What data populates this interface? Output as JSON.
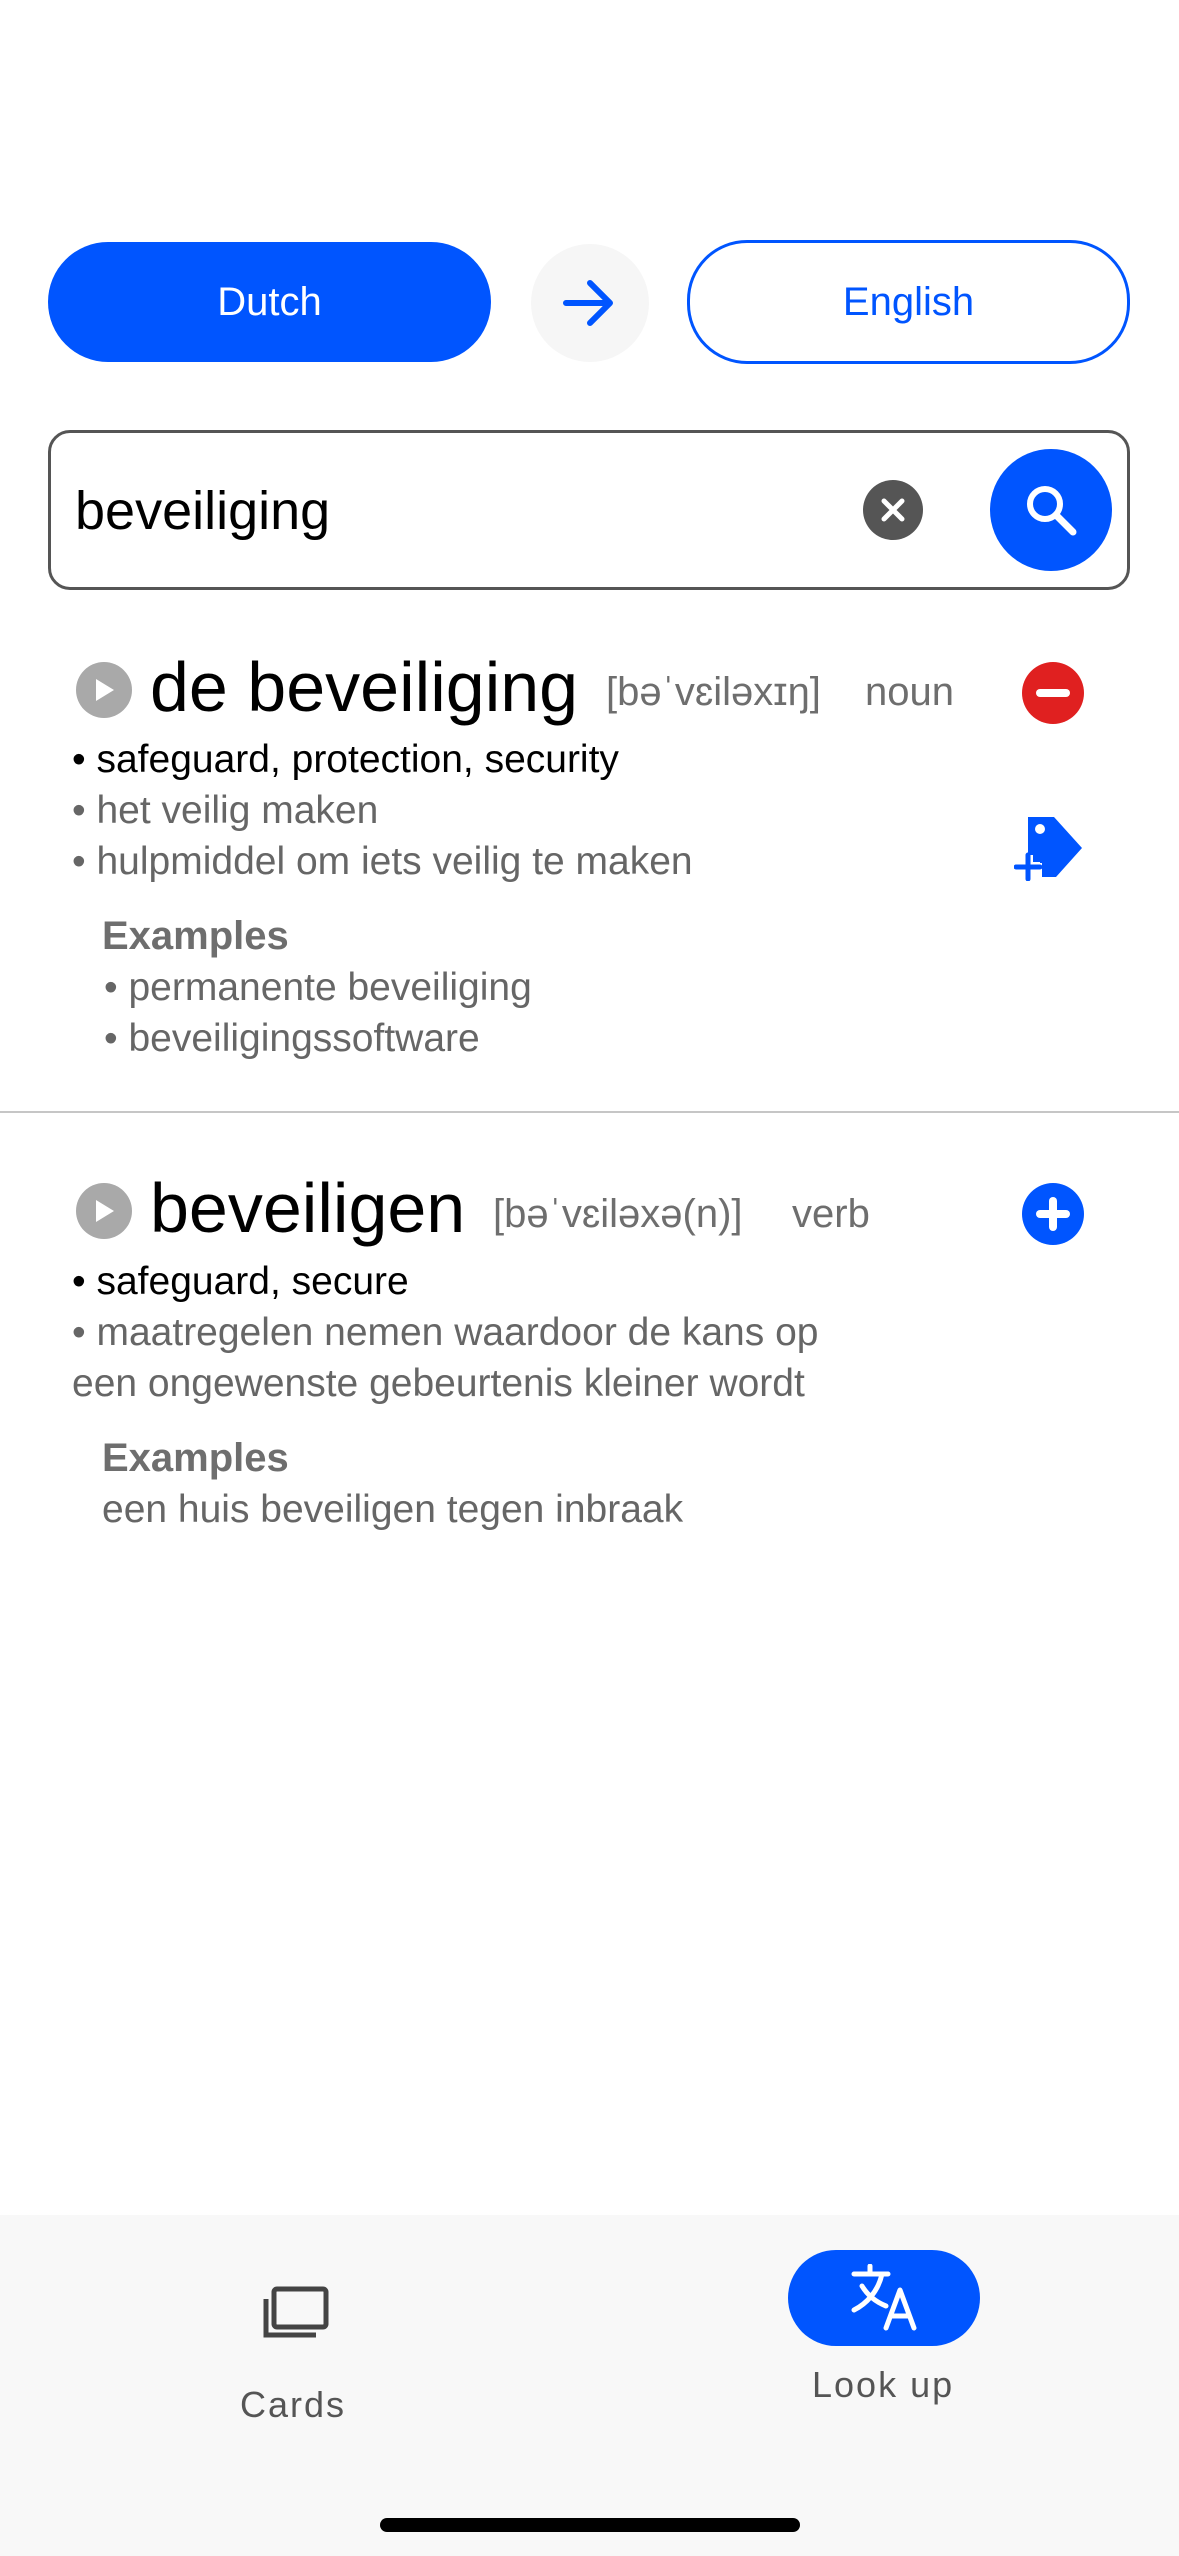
{
  "languages": {
    "source": "Dutch",
    "target": "English"
  },
  "search": {
    "value": "beveiliging",
    "placeholder": ""
  },
  "entries": [
    {
      "headword": "de beveiliging",
      "pronunciation": "[bəˈvɛiləxɪŋ]",
      "pos": "noun",
      "action": "remove",
      "lines": [
        "• safeguard, protection, security",
        "• het veilig maken",
        "• hulpmiddel om iets veilig te maken"
      ],
      "examples_heading": "Examples",
      "examples": [
        "• permanente beveiliging",
        "• beveiligingssoftware"
      ]
    },
    {
      "headword": "beveiligen",
      "pronunciation": "[bəˈvɛiləxə(n)]",
      "pos": "verb",
      "action": "add",
      "lines": [
        "• safeguard, secure",
        "• maatregelen nemen waardoor de kans op",
        "een ongewenste gebeurtenis kleiner wordt"
      ],
      "examples_heading": "Examples",
      "examples": [
        "een huis beveiligen tegen inbraak"
      ]
    }
  ],
  "nav": {
    "cards": "Cards",
    "lookup": "Look up",
    "active": "lookup"
  },
  "colors": {
    "accent": "#0055ff",
    "remove": "#e02020",
    "muted": "#6e6e6e"
  }
}
